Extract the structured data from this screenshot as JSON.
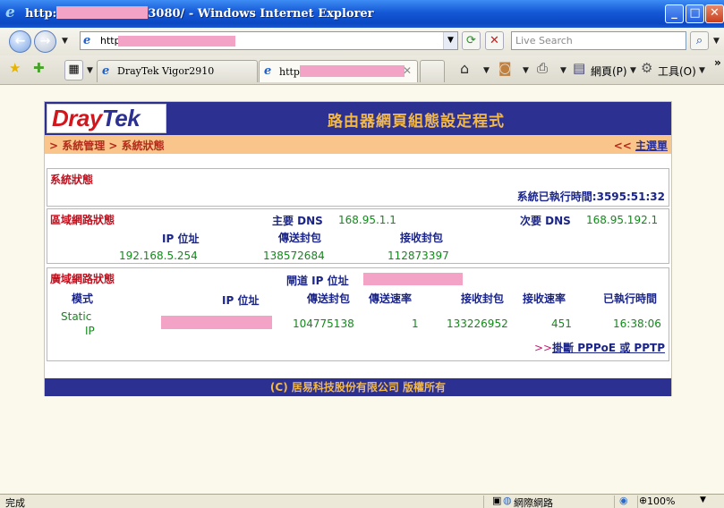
{
  "window": {
    "title_prefix": "http:",
    "title_suffix": "3080/ - Windows Internet Explorer",
    "minimize": "_",
    "maximize": "□",
    "close": "✕"
  },
  "address": {
    "prefix": "http:",
    "search_placeholder": "Live Search"
  },
  "tabs": [
    {
      "label": "DrayTek Vigor2910"
    },
    {
      "label": "http"
    }
  ],
  "commands": {
    "page": "網頁(P)",
    "tools": "工具(O)"
  },
  "router": {
    "brand_red": "Dray",
    "brand_blue": "Tek",
    "header_title": "路由器網頁組態設定程式",
    "breadcrumb": "> 系統管理 > 系統狀態",
    "main_menu_prefix": "<<",
    "main_menu_link": "主選單",
    "system": {
      "title": "系統狀態",
      "uptime_label": "系統已執行時間:",
      "uptime_value": "3595:51:32"
    },
    "lan": {
      "title": "區域網路狀態",
      "primary_dns_label": "主要 DNS",
      "primary_dns": "168.95.1.1",
      "secondary_dns_label": "次要 DNS",
      "secondary_dns": "168.95.192.1",
      "col_ip": "IP 位址",
      "col_tx": "傳送封包",
      "col_rx": "接收封包",
      "ip": "192.168.5.254",
      "tx": "138572684",
      "rx": "112873397"
    },
    "wan": {
      "title": "廣域網路狀態",
      "gateway_label": "閘道 IP 位址",
      "col_mode": "模式",
      "col_ip": "IP 位址",
      "col_tx": "傳送封包",
      "col_tx_rate": "傳送速率",
      "col_rx": "接收封包",
      "col_rx_rate": "接收速率",
      "col_uptime": "已執行時間",
      "mode_line1": "Static",
      "mode_line2": "IP",
      "tx": "104775138",
      "tx_rate": "1",
      "rx": "133226952",
      "rx_rate": "451",
      "uptime": "16:38:06",
      "link_prefix": ">>",
      "link_label": "掛斷 PPPoE 或 PPTP"
    },
    "footer": "(C) 居易科技股份有限公司 版權所有"
  },
  "statusbar": {
    "status": "完成",
    "zone": "網際網路",
    "zoom": "100%"
  }
}
